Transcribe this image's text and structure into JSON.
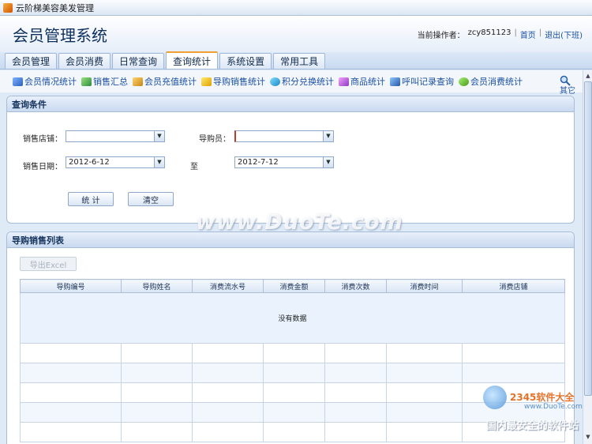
{
  "window": {
    "title": "云阶梯美容美发管理"
  },
  "header": {
    "system_title": "会员管理系统",
    "operator_label": "当前操作者：",
    "operator": "zcy851123",
    "home_link": "首页",
    "logout_link": "退出(下班)"
  },
  "tabs": [
    "会员管理",
    "会员消费",
    "日常查询",
    "查询统计",
    "系统设置",
    "常用工具"
  ],
  "active_tab": "查询统计",
  "subtools": [
    {
      "label": "会员情况统计",
      "icon": "chart-icon"
    },
    {
      "label": "销售汇总",
      "icon": "bar-chart-icon"
    },
    {
      "label": "会员充值统计",
      "icon": "coins-icon"
    },
    {
      "label": "导购销售统计",
      "icon": "guide-icon"
    },
    {
      "label": "积分兑换统计",
      "icon": "exchange-icon"
    },
    {
      "label": "商品统计",
      "icon": "goods-icon"
    },
    {
      "label": "呼叫记录查询",
      "icon": "call-icon"
    },
    {
      "label": "会员消费统计",
      "icon": "consume-icon"
    }
  ],
  "subtools_overflow_label": "其它",
  "query": {
    "title": "查询条件",
    "store_label": "销售店铺：",
    "store_value": "",
    "guide_label": "导购员：",
    "guide_value": "",
    "date_label": "销售日期：",
    "date_from": "2012-6-12",
    "to_label": "至",
    "date_to": "2012-7-12",
    "stat_button": "统 计",
    "clear_button": "清空"
  },
  "list": {
    "title": "导购销售列表",
    "export_button": "导出Excel",
    "columns": [
      "导购编号",
      "导购姓名",
      "消费流水号",
      "消费金额",
      "消费次数",
      "消费时间",
      "消费店铺"
    ],
    "empty_text": "没有数据"
  },
  "watermark": {
    "main": "www.DuoTe.com",
    "brand": "2345软件大全",
    "url": "www.DuoTe.com",
    "slogan": "国内最安全的软件站"
  }
}
